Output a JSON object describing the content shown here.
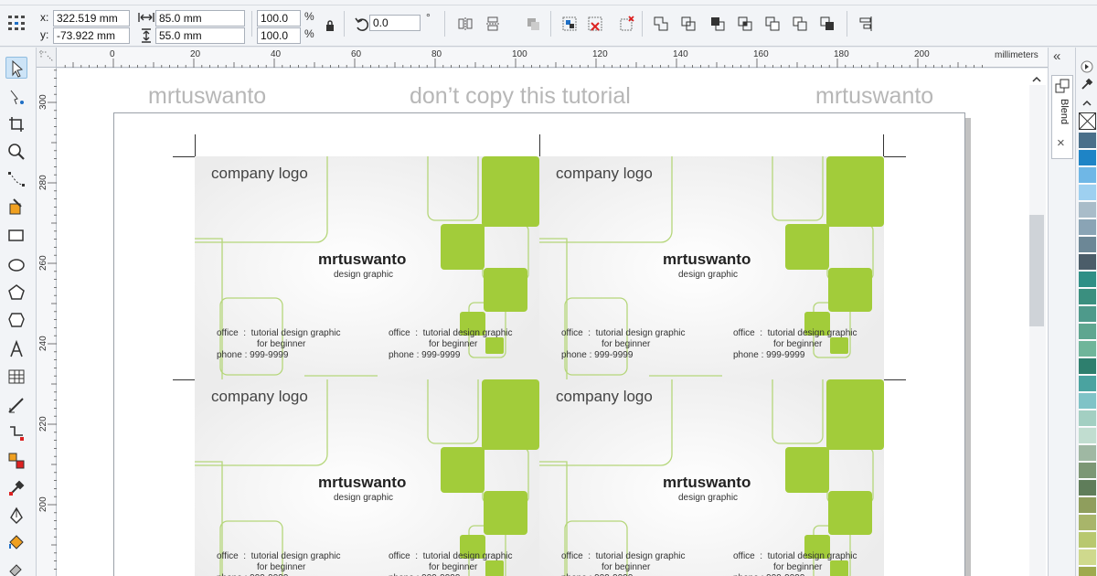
{
  "propbar": {
    "x_label": "x:",
    "x_value": "322.519 mm",
    "y_label": "y:",
    "y_value": "-73.922 mm",
    "width_value": "85.0 mm",
    "height_value": "55.0 mm",
    "scale_x": "100.0",
    "scale_y": "100.0",
    "percent": "%",
    "rotation": "0.0",
    "degree": "°"
  },
  "ruler": {
    "unit": "millimeters",
    "h_ticks": [
      "0",
      "20",
      "40",
      "60",
      "80",
      "100",
      "120",
      "140",
      "160",
      "180",
      "200"
    ],
    "v_ticks": [
      "300",
      "280",
      "260",
      "240",
      "220",
      "200"
    ]
  },
  "watermarks": {
    "left": "mrtuswanto",
    "center": "don’t copy this tutorial",
    "right": "mrtuswanto"
  },
  "card": {
    "logo": "company logo",
    "name": "mrtuswanto",
    "subtitle": "design graphic",
    "office_label": "office",
    "sep": ":",
    "office_value": "tutorial design graphic",
    "office_value2": "for beginner",
    "phone_label": "phone :",
    "phone_value": "999-9999"
  },
  "docker": {
    "collapse": "«",
    "tab_label": "Blend",
    "close": "×"
  },
  "colors": {
    "accent_green": "#a2cc3a",
    "line_green": "#b5d67a",
    "palette": [
      "#ffffff",
      "#4a6f8a",
      "#1e84c6",
      "#6fb7e6",
      "#9ed0f0",
      "#a9bcc9",
      "#8aa4b5",
      "#6c8796",
      "#4b5d69",
      "#2f8f86",
      "#3a8f7f",
      "#4e9a8b",
      "#5ea690",
      "#6fb59a",
      "#2e7f6e",
      "#4aa3a0",
      "#7fc3c7",
      "#a3cfc2",
      "#c1ddd0",
      "#9fb8a3",
      "#7c9775",
      "#5f7d5a",
      "#8f9e5d",
      "#a8b56a",
      "#b8c86f",
      "#cfd98d",
      "#9faa4e"
    ]
  }
}
